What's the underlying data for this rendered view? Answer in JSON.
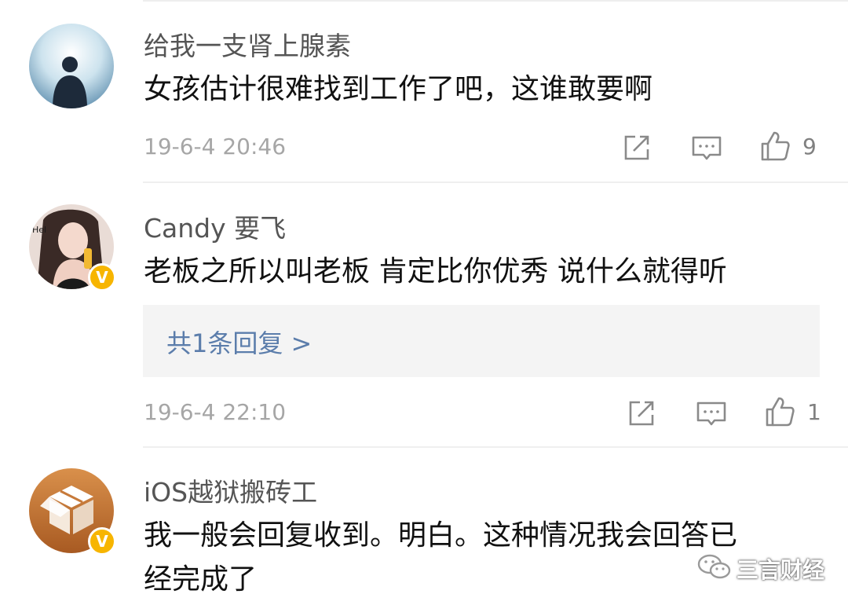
{
  "comments": [
    {
      "username": "给我一支肾上腺素",
      "text_lines": [
        "女孩估计很难找到工作了吧，这谁敢要啊"
      ],
      "time": "19-6-4 20:46",
      "likes": "9",
      "verified": false
    },
    {
      "username": "Candy 要飞",
      "text_lines": [
        "老板之所以叫老板 肯定比你优秀 说什么就得听"
      ],
      "reply_link": "共1条回复 >",
      "time": "19-6-4 22:10",
      "likes": "1",
      "verified": true
    },
    {
      "username": "iOS越狱搬砖工",
      "text_lines": [
        "我一般会回复收到。明白。这种情况我会回答已",
        "经完成了"
      ],
      "verified": true
    }
  ],
  "icons": [
    "share-icon",
    "comment-icon",
    "like-icon",
    "verified-badge-icon",
    "wechat-icon"
  ],
  "badge_glyph": "V",
  "watermark": "三言财经",
  "colors": {
    "username": "#555555",
    "text": "#111111",
    "reply_link": "#5b7dab",
    "time": "#a6a6a6",
    "badge": "#f7b500",
    "reply_bg": "#f4f4f4"
  }
}
